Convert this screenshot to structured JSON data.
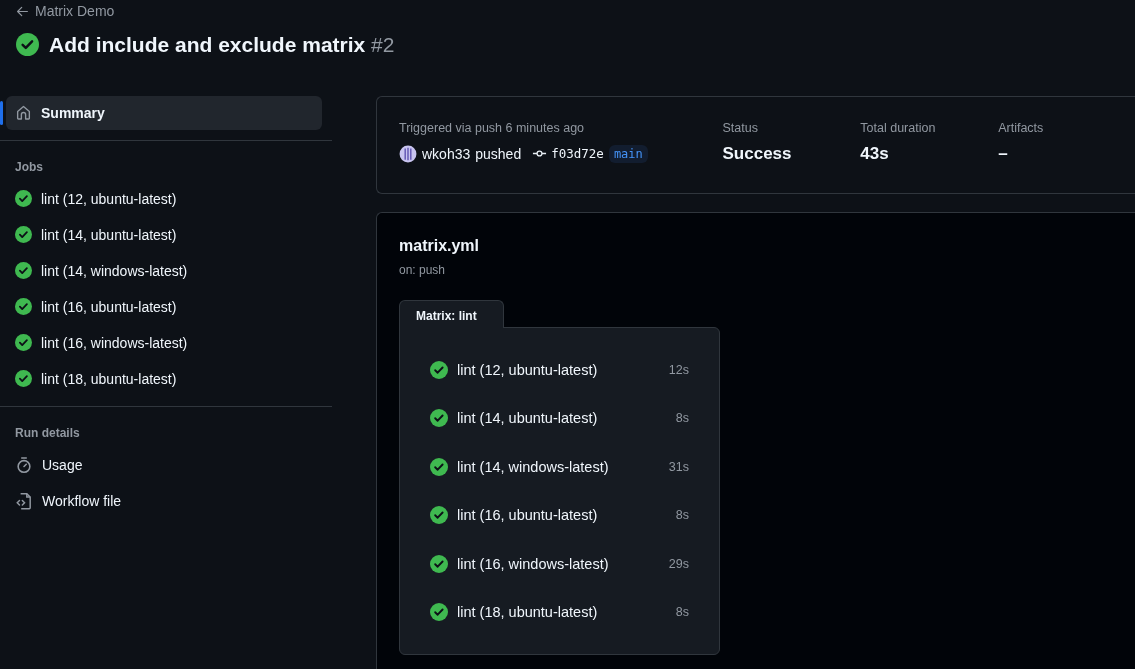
{
  "header": {
    "back_link": "Matrix Demo",
    "kind": "success",
    "title": "Add include and exclude matrix",
    "run_number": "#2"
  },
  "sidebar": {
    "summary": {
      "label": "Summary",
      "selected": true
    },
    "jobs_heading": "Jobs",
    "jobs": [
      {
        "label": "lint (12, ubuntu-latest)",
        "kind": "success",
        "selected": false
      },
      {
        "label": "lint (14, ubuntu-latest)",
        "kind": "success",
        "selected": false
      },
      {
        "label": "lint (14, windows-latest)",
        "kind": "success",
        "selected": false
      },
      {
        "label": "lint (16, ubuntu-latest)",
        "kind": "success",
        "selected": false
      },
      {
        "label": "lint (16, windows-latest)",
        "kind": "success",
        "selected": false
      },
      {
        "label": "lint (18, ubuntu-latest)",
        "kind": "success",
        "selected": false
      }
    ],
    "details_heading": "Run details",
    "details": [
      {
        "kind": "usage",
        "label": "Usage",
        "selected": false
      },
      {
        "kind": "workflow",
        "label": "Workflow file",
        "selected": false
      }
    ]
  },
  "summary_card": {
    "trigger_label": "Triggered via push 6 minutes ago",
    "actor": "wkoh33",
    "action": "pushed",
    "commit": "f03d72e",
    "branch": "main",
    "stats": [
      {
        "label": "Status",
        "value": "Success"
      },
      {
        "label": "Total duration",
        "value": "43s"
      },
      {
        "label": "Artifacts",
        "value": "–"
      }
    ]
  },
  "workflow": {
    "file": "matrix.yml",
    "trigger": "on: push",
    "matrix_label": "Matrix: lint",
    "jobs": [
      {
        "label": "lint (12, ubuntu-latest)",
        "kind": "success",
        "duration": "12s"
      },
      {
        "label": "lint (14, ubuntu-latest)",
        "kind": "success",
        "duration": "8s"
      },
      {
        "label": "lint (14, windows-latest)",
        "kind": "success",
        "duration": "31s"
      },
      {
        "label": "lint (16, ubuntu-latest)",
        "kind": "success",
        "duration": "8s"
      },
      {
        "label": "lint (16, windows-latest)",
        "kind": "success",
        "duration": "29s"
      },
      {
        "label": "lint (18, ubuntu-latest)",
        "kind": "success",
        "duration": "8s"
      }
    ]
  }
}
